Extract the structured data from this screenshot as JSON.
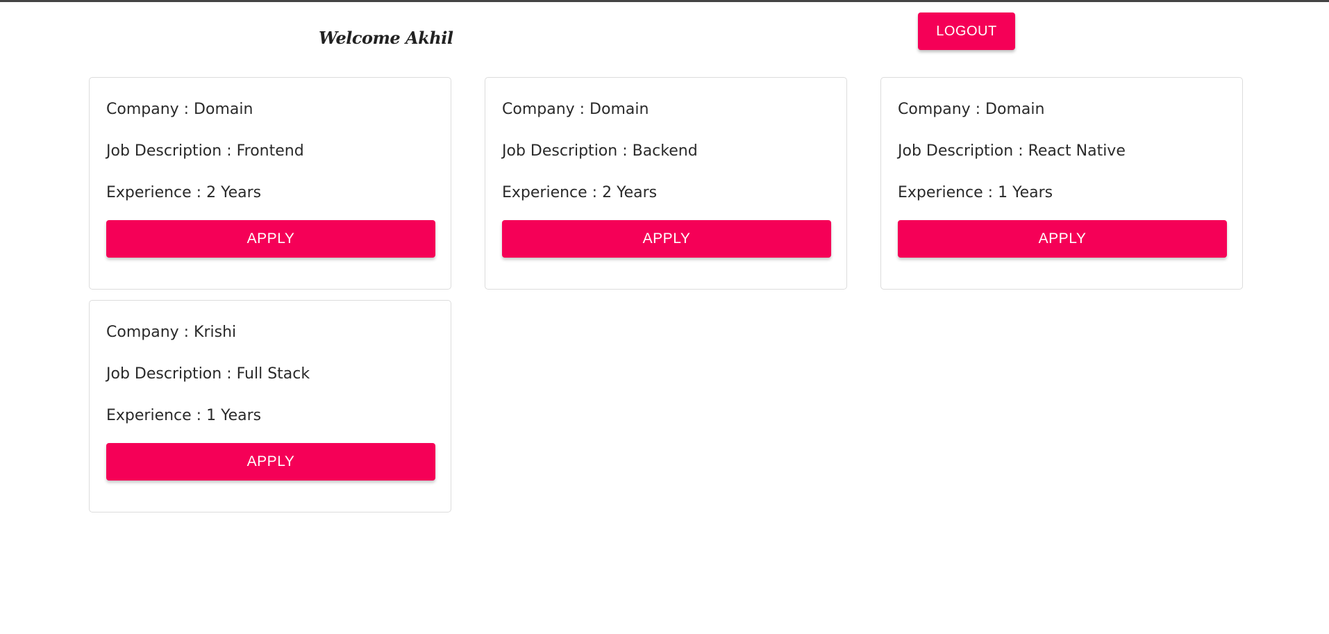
{
  "header": {
    "welcome_text": "Welcome Akhil",
    "logout_label": "LOGOUT"
  },
  "theme": {
    "accent": "#f50057",
    "card_border": "#dcdcdc"
  },
  "jobs": [
    {
      "company_line": "Company : Domain",
      "description_line": "Job Description : Frontend",
      "experience_line": "Experience : 2 Years",
      "apply_label": "APPLY"
    },
    {
      "company_line": "Company : Domain",
      "description_line": "Job Description : Backend",
      "experience_line": "Experience : 2 Years",
      "apply_label": "APPLY"
    },
    {
      "company_line": "Company : Domain",
      "description_line": "Job Description : React Native",
      "experience_line": "Experience : 1 Years",
      "apply_label": "APPLY"
    },
    {
      "company_line": "Company : Krishi",
      "description_line": "Job Description : Full Stack",
      "experience_line": "Experience : 1 Years",
      "apply_label": "APPLY"
    }
  ]
}
